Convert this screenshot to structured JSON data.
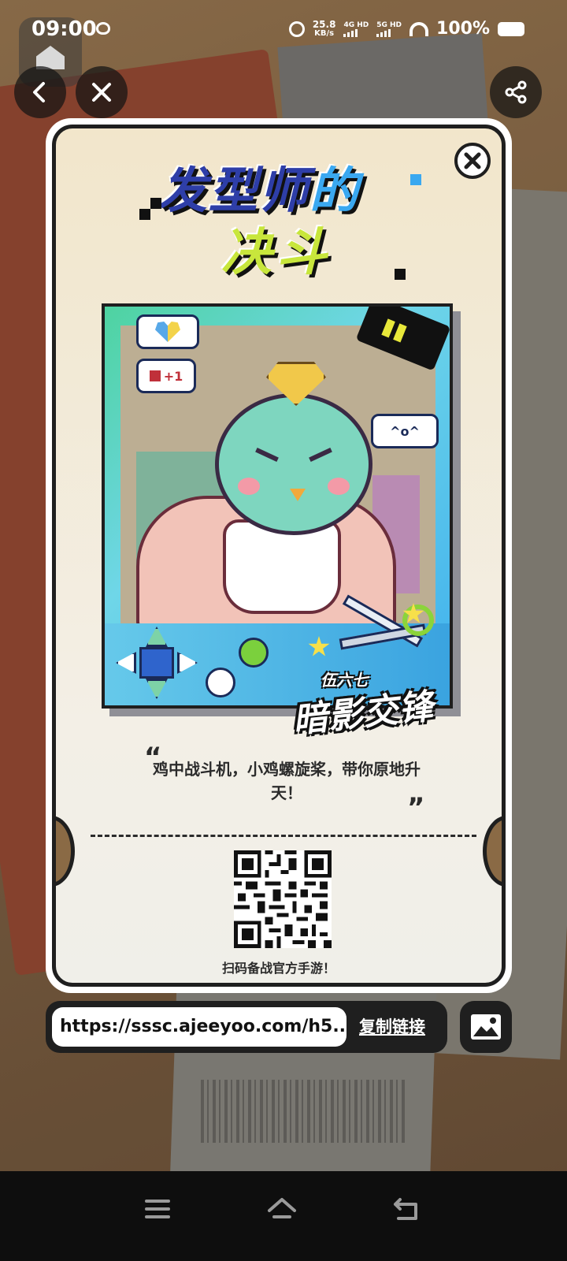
{
  "status_bar": {
    "time": "09:00",
    "net_speed_value": "25.8",
    "net_speed_unit": "KB/s",
    "sim1": "4G HD",
    "sim2": "5G HD",
    "battery": "100%"
  },
  "nav": {
    "back_icon": "chevron-left-icon",
    "close_icon": "close-icon",
    "share_icon": "share-icon"
  },
  "card": {
    "title_line1_a": "发型师",
    "title_line1_b": "的",
    "title_line2": "决斗",
    "bubble_like": "+1",
    "bubble_face": "^o^",
    "brand_top": "伍六七",
    "brand_main": "暗影交锋",
    "quote": "鸡中战斗机，小鸡螺旋桨，带你原地升天！",
    "quote_open": "“",
    "quote_close": "”",
    "qr_caption": "扫码备战官方手游！"
  },
  "link_bar": {
    "url": "https://sssc.ajeeyoo.com/h5...",
    "copy_label": "复制链接"
  },
  "colors": {
    "card_bg": "#f2e6cb",
    "outline": "#1f1f1f",
    "title_blue": "#3aa8f0",
    "title_green": "#c8e63c"
  }
}
